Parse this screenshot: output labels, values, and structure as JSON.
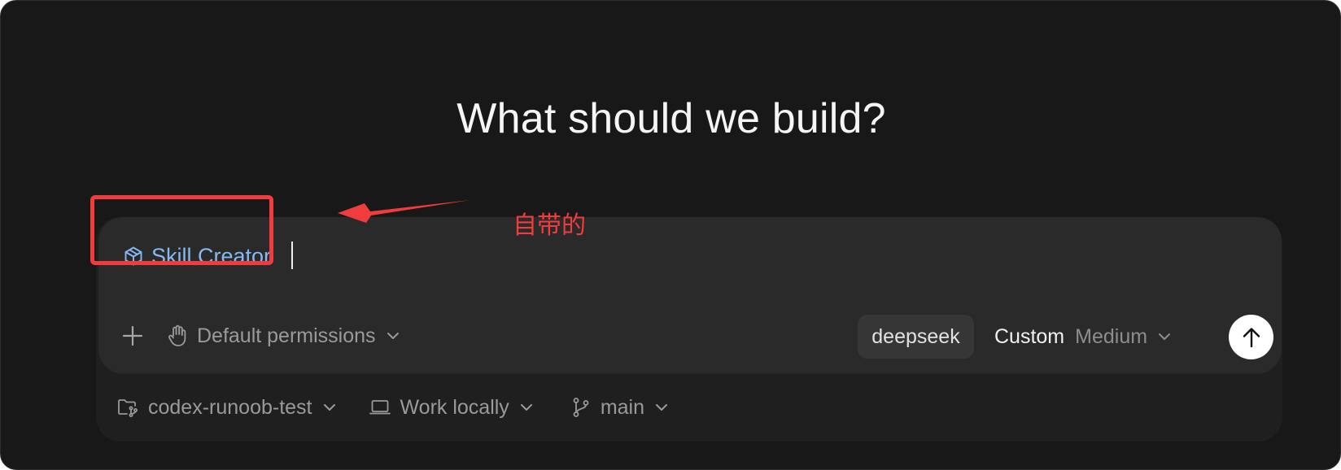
{
  "heading": "What should we build?",
  "composer": {
    "skill_chip": {
      "label": "Skill Creator",
      "icon": "cube-icon",
      "color": "#86b9f2"
    },
    "toolbar": {
      "add_icon": "plus-icon",
      "permissions": {
        "icon": "hand-icon",
        "label": "Default permissions"
      },
      "model": "deepseek",
      "effort": {
        "mode": "Custom",
        "level": "Medium"
      },
      "send_icon": "arrow-up-icon"
    }
  },
  "footer": {
    "project": {
      "icon": "folder-git-icon",
      "label": "codex-runoob-test"
    },
    "environment": {
      "icon": "laptop-icon",
      "label": "Work locally"
    },
    "branch": {
      "icon": "git-branch-icon",
      "label": "main"
    }
  },
  "annotation": {
    "text": "自带的",
    "color": "#f03c3c"
  }
}
